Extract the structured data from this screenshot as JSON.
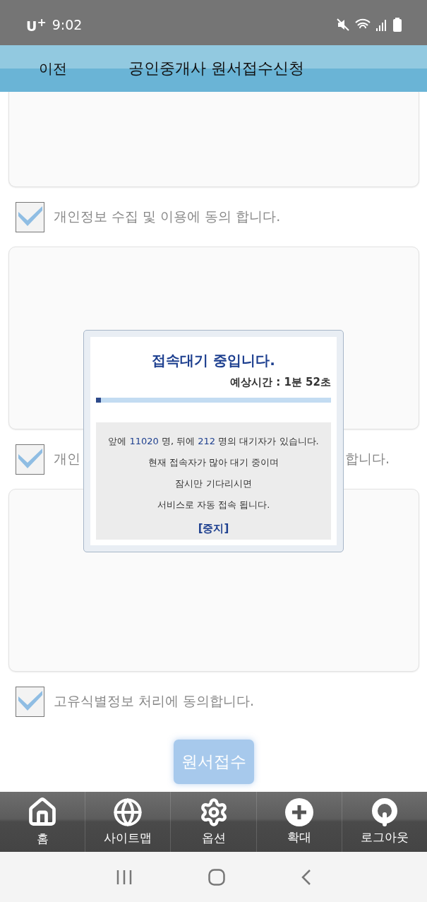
{
  "status_bar": {
    "carrier": "U",
    "carrier_sup": "+",
    "time": "9:02"
  },
  "header": {
    "back": "이전",
    "title": "공인중개사 원서접수신청"
  },
  "agreements": [
    {
      "label_parts": [
        "개인정보 수집 및 이용에 동의 합니다."
      ],
      "checked": true
    },
    {
      "label_parts": [
        "개인",
        "합니다."
      ],
      "checked": true
    },
    {
      "label_parts": [
        "고유식별정보 처리에 동의합니다."
      ],
      "checked": true
    }
  ],
  "submit_button": "원서접수",
  "wait_dialog": {
    "title": "접속대기 중입니다.",
    "estimate": "예상시간 : 1분 52초",
    "level": 0.02,
    "lines": [
      "앞에 **11020** 명, 뒤에 **212** 명의 대기자가 있습니다.",
      "현재 접속자가 많아 대기 중이며",
      "잠시만 기다리시면",
      "서비스로 자동 접속 됩니다."
    ],
    "stop": "[중지]"
  },
  "bottom_menu": [
    {
      "kind": "home",
      "label": "홈"
    },
    {
      "kind": "sitemap",
      "label": "사이트맵"
    },
    {
      "kind": "options",
      "label": "옵션"
    },
    {
      "kind": "zoom",
      "label": "확대"
    },
    {
      "kind": "logout",
      "label": "로그아웃"
    }
  ]
}
